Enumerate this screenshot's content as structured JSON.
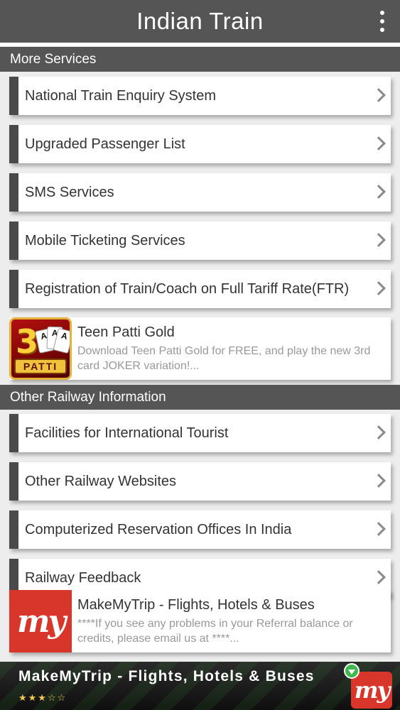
{
  "app_bar": {
    "title": "Indian Train"
  },
  "sections": [
    {
      "header": "More Services",
      "items": [
        {
          "label": "National Train Enquiry System"
        },
        {
          "label": "Upgraded Passenger List"
        },
        {
          "label": "SMS Services"
        },
        {
          "label": "Mobile Ticketing Services"
        },
        {
          "label": "Registration of Train/Coach on Full Tariff Rate(FTR)"
        }
      ]
    },
    {
      "header": "Other Railway Information",
      "items": [
        {
          "label": "Facilities for International Tourist"
        },
        {
          "label": "Other Railway Websites"
        },
        {
          "label": "Computerized Reservation Offices In India"
        },
        {
          "label": "Railway Feedback"
        }
      ]
    }
  ],
  "ads": {
    "teen_patti": {
      "title": "Teen Patti Gold",
      "description": "Download Teen Patti Gold for FREE, and play the new 3rd card JOKER variation!...",
      "icon": "teen-patti-icon",
      "icon_digit": "3",
      "icon_cards": [
        "A",
        "A",
        "A"
      ],
      "icon_banner": "PATTI"
    },
    "makemytrip_card": {
      "title": "MakeMyTrip - Flights, Hotels & Buses",
      "description": "****If you see any problems in your Referral balance or credits, please email us at ****...",
      "icon": "makemytrip-icon",
      "logo_text": "my"
    },
    "bottom_banner": {
      "title": "MakeMyTrip - Flights, Hotels & Buses",
      "stars": "★★★☆☆",
      "rating_stars": 3,
      "logo_text": "my"
    }
  },
  "colors": {
    "app_bar": "#555555",
    "section_header": "#555555",
    "list_accent": "#4a4a4a",
    "background": "#ededed",
    "makemytrip_red": "#d8362a"
  }
}
